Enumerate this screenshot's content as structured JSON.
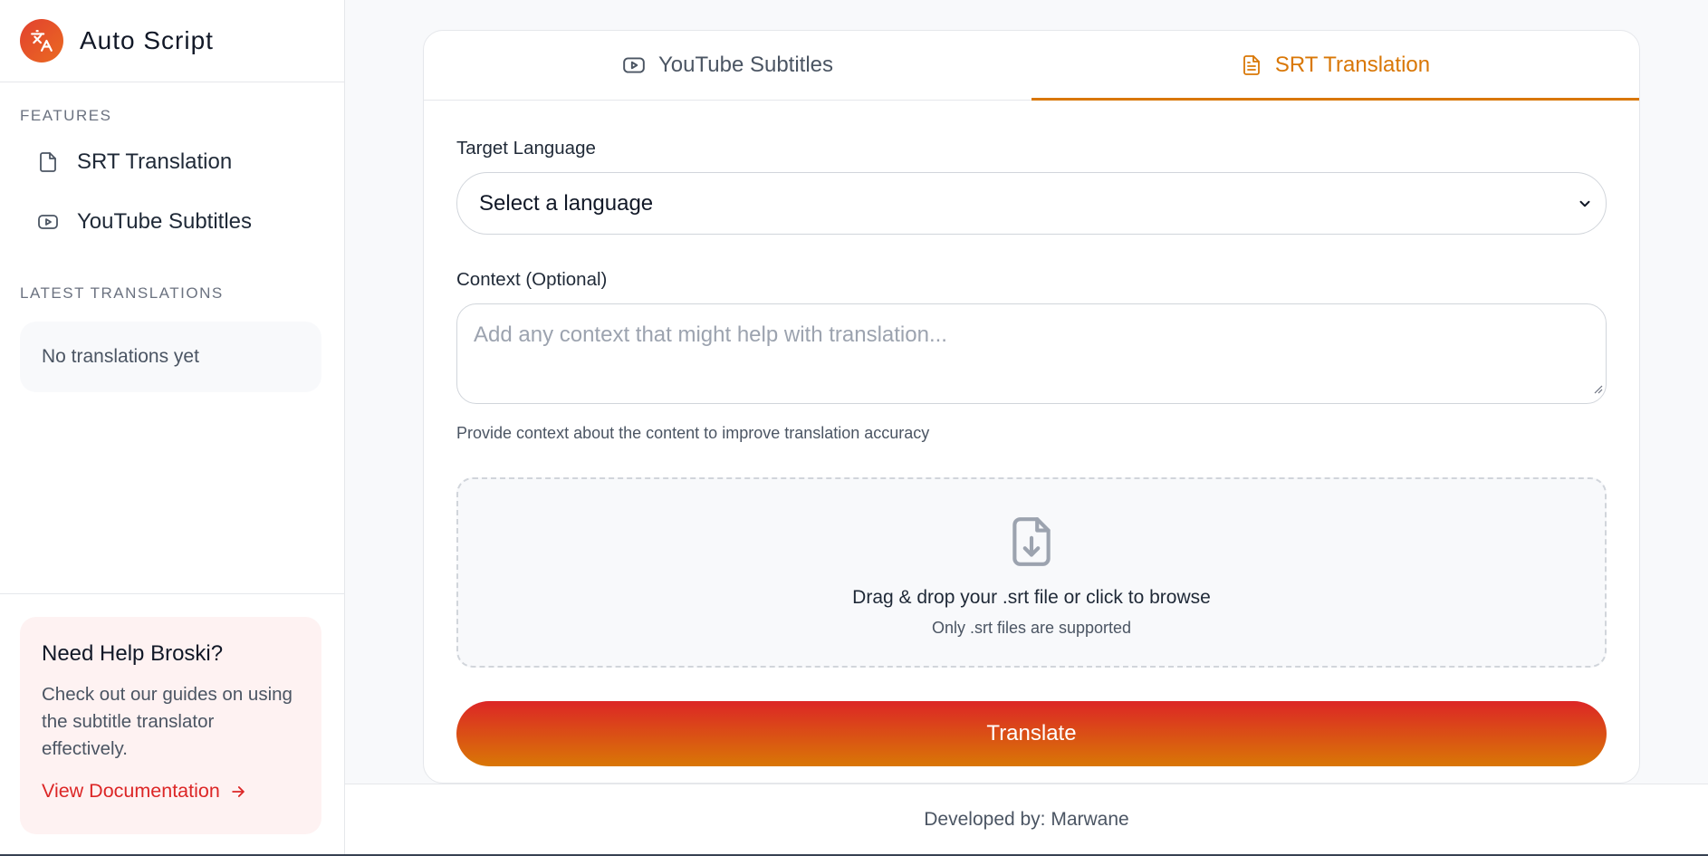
{
  "app": {
    "title": "Auto Script",
    "logo_icon": "translate-icon",
    "accent_color": "#d97706",
    "brand_gradient": [
      "#e2412f",
      "#ea6a21"
    ]
  },
  "sidebar": {
    "features_label": "FEATURES",
    "items": [
      {
        "label": "SRT Translation",
        "icon": "file-icon"
      },
      {
        "label": "YouTube Subtitles",
        "icon": "youtube-icon"
      }
    ],
    "latest_label": "LATEST TRANSLATIONS",
    "latest_empty": "No translations yet",
    "help": {
      "title": "Need Help Broski?",
      "text": "Check out our guides on using the subtitle translator effectively.",
      "link": "View Documentation",
      "link_icon": "arrow-right-icon",
      "link_color": "#dc2626"
    }
  },
  "tabs": [
    {
      "label": "YouTube Subtitles",
      "icon": "youtube-icon",
      "active": false
    },
    {
      "label": "SRT Translation",
      "icon": "document-text-icon",
      "active": true
    }
  ],
  "form": {
    "target_language_label": "Target Language",
    "target_language_value": "Select a language",
    "context_label": "Context (Optional)",
    "context_placeholder": "Add any context that might help with translation...",
    "context_hint": "Provide context about the content to improve translation accuracy",
    "dropzone_title": "Drag & drop your .srt file or click to browse",
    "dropzone_subtitle": "Only .srt files are supported",
    "dropzone_icon": "file-download-icon",
    "submit_label": "Translate",
    "submit_gradient": [
      "#dc2626",
      "#d97706"
    ]
  },
  "footer": {
    "text": "Developed by: Marwane"
  }
}
